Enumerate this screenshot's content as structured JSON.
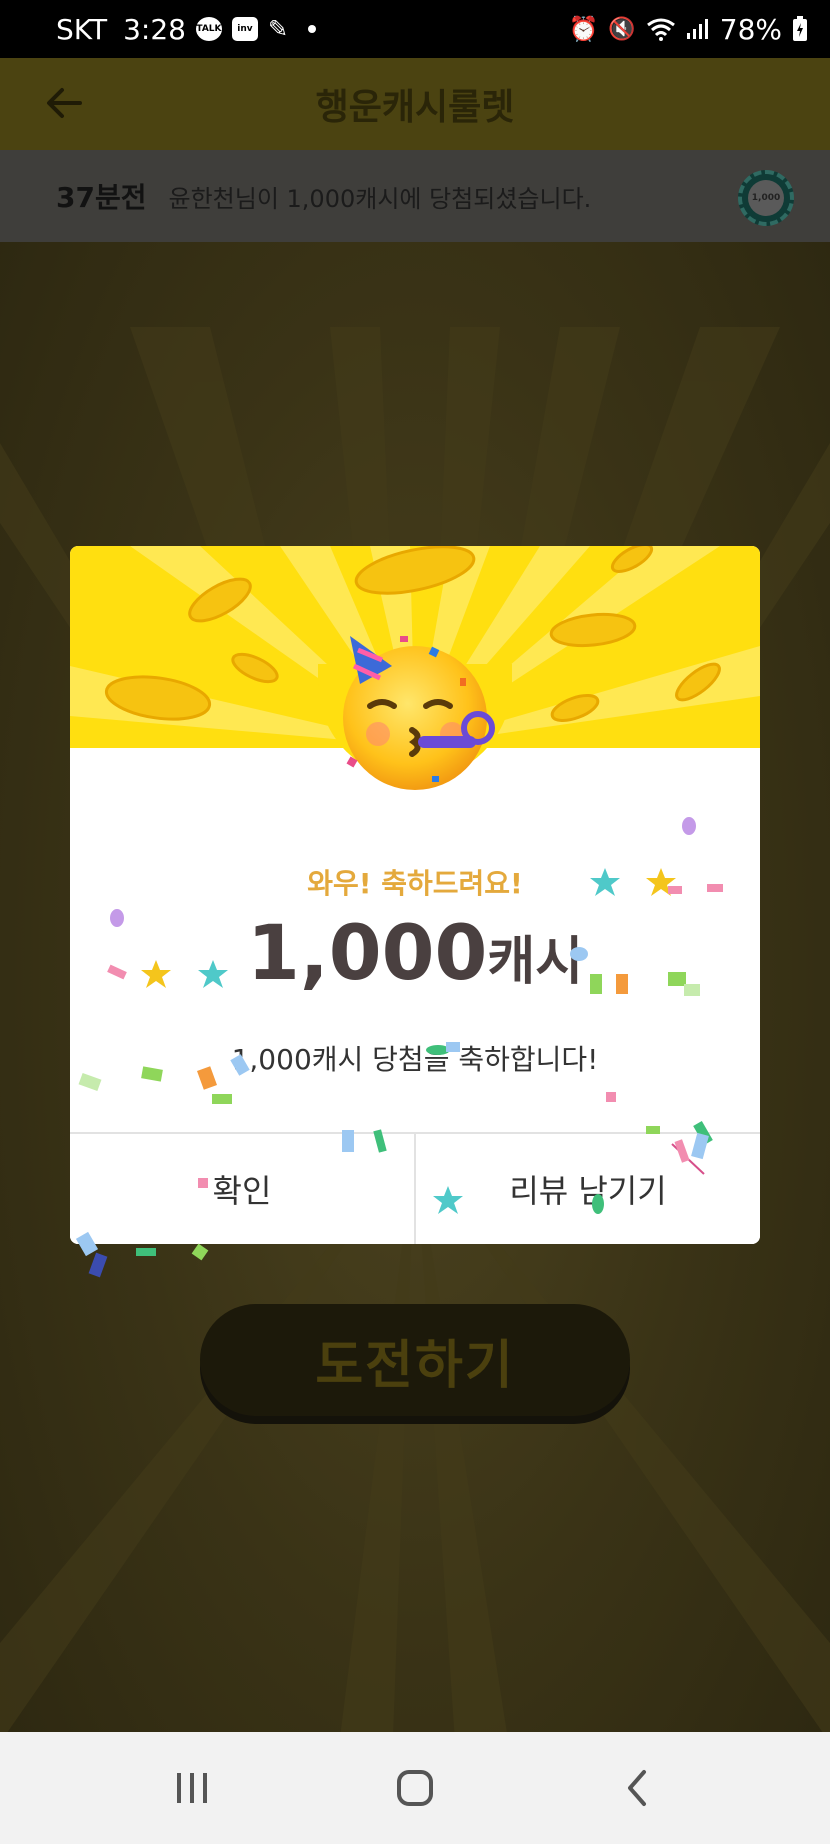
{
  "status_bar": {
    "carrier": "SKT",
    "time": "3:28",
    "app_icons": [
      "TALK",
      "inv"
    ],
    "battery": "78%"
  },
  "header": {
    "title": "행운캐시룰렛"
  },
  "ticker": {
    "time_ago": "37분전",
    "message": "윤한천님이 1,000캐시에 당첨되셨습니다.",
    "coin_badge": "1,000"
  },
  "challenge_button": {
    "label": "도전하기"
  },
  "dialog": {
    "wow": "와우! 축하드려요!",
    "amount_number": "1,000",
    "amount_unit": "캐시",
    "message": "1,000캐시 당첨을 축하합니다!",
    "confirm_label": "확인",
    "review_label": "리뷰 남기기"
  },
  "colors": {
    "accent_yellow": "#ffdf10",
    "wow_orange": "#e4a93c",
    "amount_text": "#4a4040"
  },
  "icons": {
    "back": "arrow-left-icon",
    "emoji": "partying-face-icon",
    "nav_recent": "recent-apps-icon",
    "nav_home": "home-icon",
    "nav_back": "back-chevron-icon"
  }
}
